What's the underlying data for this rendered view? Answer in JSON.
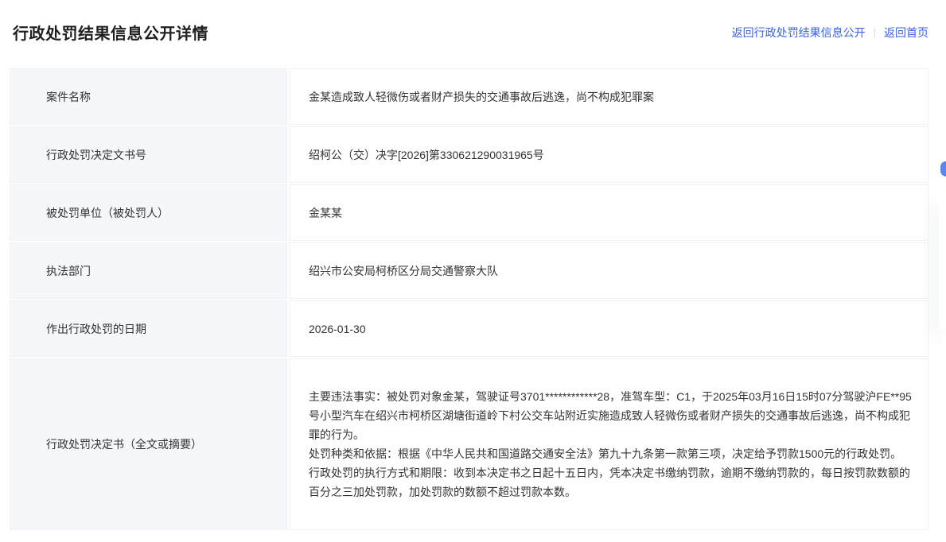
{
  "page": {
    "title": "行政处罚结果信息公开详情",
    "links": {
      "back_to_list": "返回行政处罚结果信息公开",
      "back_home": "返回首页",
      "divider": "|"
    },
    "link_color": "#3a63e8"
  },
  "table": {
    "rows": [
      {
        "label": "案件名称",
        "value": "金某造成致人轻微伤或者财产损失的交通事故后逃逸，尚不构成犯罪案"
      },
      {
        "label": "行政处罚决定文书号",
        "value": "绍柯公（交）决字[2026]第330621290031965号"
      },
      {
        "label": "被处罚单位（被处罚人）",
        "value": "金某某"
      },
      {
        "label": "执法部门",
        "value": "绍兴市公安局柯桥区分局交通警察大队"
      },
      {
        "label": "作出行政处罚的日期",
        "value": "2026-01-30"
      }
    ],
    "decision_row": {
      "label": "行政处罚决定书（全文或摘要）",
      "paragraphs": [
        "主要违法事实：被处罚对象金某，驾驶证号3701************28，准驾车型：C1，于2025年03月16日15时07分驾驶沪FE**95号小型汽车在绍兴市柯桥区湖塘街道岭下村公交车站附近实施造成致人轻微伤或者财产损失的交通事故后逃逸，尚不构成犯罪的行为。",
        "处罚种类和依据：根据《中华人民共和国道路交通安全法》第九十九条第一款第三项，决定给予罚款1500元的行政处罚。",
        "行政处罚的执行方式和期限：收到本决定书之日起十五日内，凭本决定书缴纳罚款，逾期不缴纳罚款的，每日按罚款数额的百分之三加处罚款，加处罚款的数额不超过罚款本数。"
      ]
    },
    "colors": {
      "label_bg": "#f6f7fa",
      "border": "#f0f1f5",
      "text": "#333333"
    }
  }
}
